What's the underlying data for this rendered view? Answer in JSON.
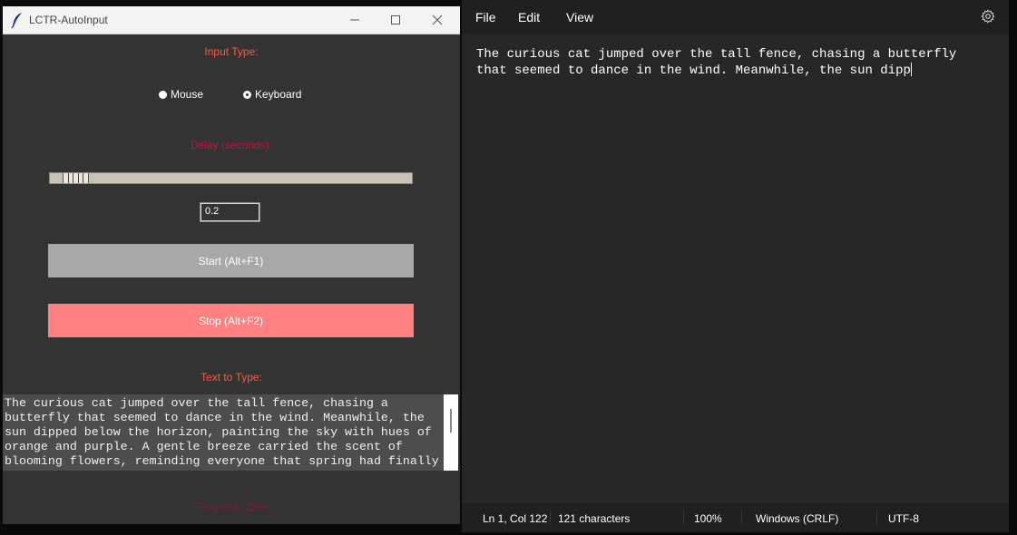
{
  "app": {
    "title": "LCTR-AutoInput",
    "input_type_label": "Input Type:",
    "radio_mouse": "Mouse",
    "radio_keyboard": "Keyboard",
    "selected_input": "Keyboard",
    "delay_label": "Delay (seconds):",
    "delay_slider_fraction": 0.04,
    "delay_value": "0.2",
    "start_button": "Start (Alt+F1)",
    "stop_button": "Stop (Alt+F2)",
    "text_label": "Text to Type:",
    "text_lines": [
      "The curious cat jumped over the tall fence, chasing a",
      "butterfly that seemed to dance in the wind. Meanwhile, the",
      "sun dipped below the horizon, painting the sky with hues of",
      "orange and purple. A gentle breeze carried the scent of",
      "blooming flowers, reminding everyone that spring had finally"
    ],
    "progress_label": "Progress: 25%",
    "colors": {
      "label_orange": "#ff5a3c",
      "label_crimson": "#c8113a",
      "progress_dim": "#7a1f33",
      "start_bg": "#a8a8a8",
      "stop_bg": "#ff8080"
    }
  },
  "notepad": {
    "menu": [
      "File",
      "Edit",
      "View"
    ],
    "settings_icon": "gear-icon",
    "content": "The curious cat jumped over the tall fence, chasing a butterfly that seemed to dance in the wind. Meanwhile, the sun dipp",
    "status": {
      "position": "Ln 1, Col 122",
      "characters": "121 characters",
      "zoom": "100%",
      "line_ending": "Windows (CRLF)",
      "encoding": "UTF-8"
    }
  }
}
